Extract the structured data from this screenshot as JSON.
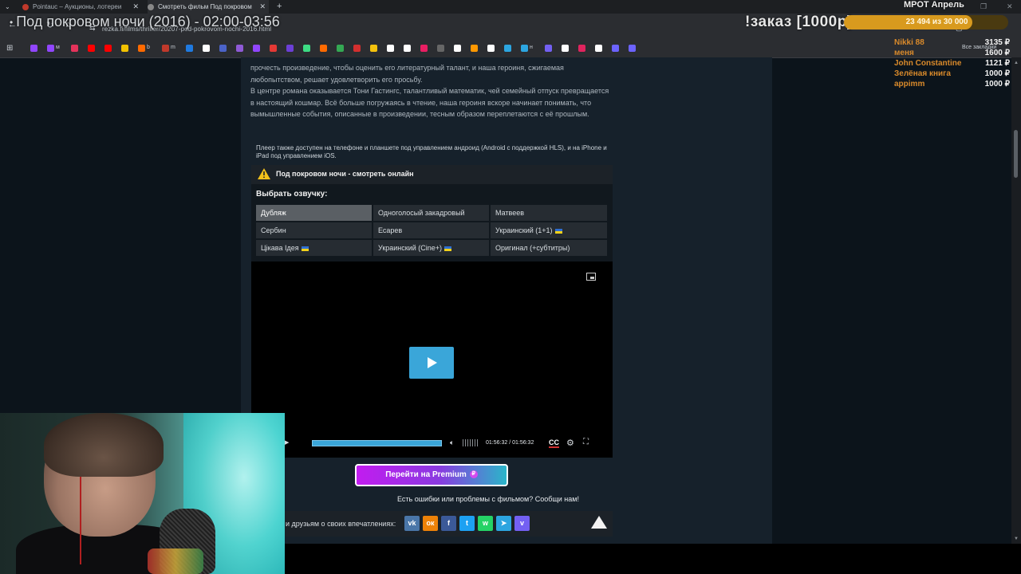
{
  "stream_title": "Под покровом ночи (2016) - 02:00-03:56",
  "tabs": [
    {
      "label": "Pointauc – Аукционы, лотереи",
      "active": false
    },
    {
      "label": "Смотреть фильм Под покровом",
      "active": true
    }
  ],
  "url": "rezka.fi/films/thriller/20207-pod-pokrovom-nochi-2016.html",
  "bookmarks": {
    "items": [
      {
        "color": "#9146ff"
      },
      {
        "color": "#9146ff",
        "label": "м"
      },
      {
        "color": "#e5335b"
      },
      {
        "color": "#ff0000"
      },
      {
        "color": "#ff0000"
      },
      {
        "color": "#f2c200"
      },
      {
        "color": "#ff6a00",
        "label": "b"
      },
      {
        "color": "#c0392b",
        "label": "m"
      },
      {
        "color": "#1f7ae0"
      },
      {
        "color": "#ffffff"
      },
      {
        "color": "#4b63c8"
      },
      {
        "color": "#8f5ad6"
      },
      {
        "color": "#9146ff"
      },
      {
        "color": "#e53935"
      },
      {
        "color": "#6c3fd6"
      },
      {
        "color": "#3ddc84"
      },
      {
        "color": "#ff6a00"
      },
      {
        "color": "#34a853"
      },
      {
        "color": "#d32f2f"
      },
      {
        "color": "#f4c20d"
      },
      {
        "color": "#ffffff"
      },
      {
        "color": "#ffffff"
      },
      {
        "color": "#e91e63"
      },
      {
        "color": "#666666"
      },
      {
        "color": "#ffffff"
      },
      {
        "color": "#ff9800"
      },
      {
        "color": "#ffffff"
      },
      {
        "color": "#2ca5e0"
      },
      {
        "color": "#2ca5e0",
        "label": "н"
      },
      {
        "color": "#7360f2"
      },
      {
        "color": "#ffffff"
      },
      {
        "color": "#e0245e"
      },
      {
        "color": "#ffffff"
      },
      {
        "color": "#6c63ff"
      },
      {
        "color": "#6c63ff"
      }
    ],
    "all_label": "Все закладки"
  },
  "overlay": {
    "order_text": "!заказ [1000р]",
    "goal_title": "МРОТ Апрель",
    "goal_text": "23 494   из 30 000",
    "goal_fraction": 0.78,
    "donors": [
      {
        "name": "Nikki 88",
        "amount": "3135 ₽"
      },
      {
        "name": "меня",
        "amount": "1600 ₽"
      },
      {
        "name": "John Constantine",
        "amount": "1121 ₽"
      },
      {
        "name": "Зелёная книга",
        "amount": "1000 ₽"
      },
      {
        "name": "appimm",
        "amount": "1000 ₽"
      }
    ]
  },
  "description": {
    "p1": "прочесть произведение, чтобы оценить его литературный талант, и наша героиня, сжигаемая любопытством, решает удовлетворить его просьбу.",
    "p2": "В центре романа оказывается Тони Гастингс, талантливый математик, чей семейный отпуск превращается в настоящий кошмар. Всё больше погружаясь в чтение, наша героиня вскоре начинает понимать, что вымышленные события, описанные в произведении, тесным образом переплетаются с её прошлым."
  },
  "player": {
    "note": "Плеер также доступен на телефоне и планшете под управлением андроид (Android с поддержкой HLS), и на iPhone и iPad под управлением iOS.",
    "title": "Под покровом ночи - смотреть онлайн",
    "voice_label": "Выбрать озвучку:",
    "voices": [
      {
        "label": "Дубляж",
        "active": true,
        "flag": false
      },
      {
        "label": "Одноголосый закадровый",
        "active": false,
        "flag": false
      },
      {
        "label": "Матвеев",
        "active": false,
        "flag": false
      },
      {
        "label": "Сербин",
        "active": false,
        "flag": false
      },
      {
        "label": "Есарев",
        "active": false,
        "flag": false
      },
      {
        "label": "Украинский (1+1)",
        "active": false,
        "flag": true
      },
      {
        "label": "Цікава Ідея",
        "active": false,
        "flag": true
      },
      {
        "label": "Украинский (Cine+)",
        "active": false,
        "flag": true
      },
      {
        "label": "Оригинал (+субтитры)",
        "active": false,
        "flag": false
      }
    ],
    "time": "01:56:32 / 01:56:32",
    "progress_fraction": 1.0,
    "cc_label": "CC",
    "premium_label": "Перейти на Premium",
    "report_label": "Есть ошибки или проблемы с фильмом? Сообщи нам!",
    "share_label": "и друзьям о своих впечатлениях:",
    "social": [
      {
        "name": "vk",
        "glyph": "vk",
        "color": "#4a76a8"
      },
      {
        "name": "ok",
        "glyph": "ок",
        "color": "#ee8208"
      },
      {
        "name": "facebook",
        "glyph": "f",
        "color": "#3b5998"
      },
      {
        "name": "twitter",
        "glyph": "t",
        "color": "#1da1f2"
      },
      {
        "name": "whatsapp",
        "glyph": "w",
        "color": "#25d366"
      },
      {
        "name": "telegram",
        "glyph": "➤",
        "color": "#2ca5e0"
      },
      {
        "name": "viber",
        "glyph": "v",
        "color": "#7360f2"
      }
    ]
  }
}
